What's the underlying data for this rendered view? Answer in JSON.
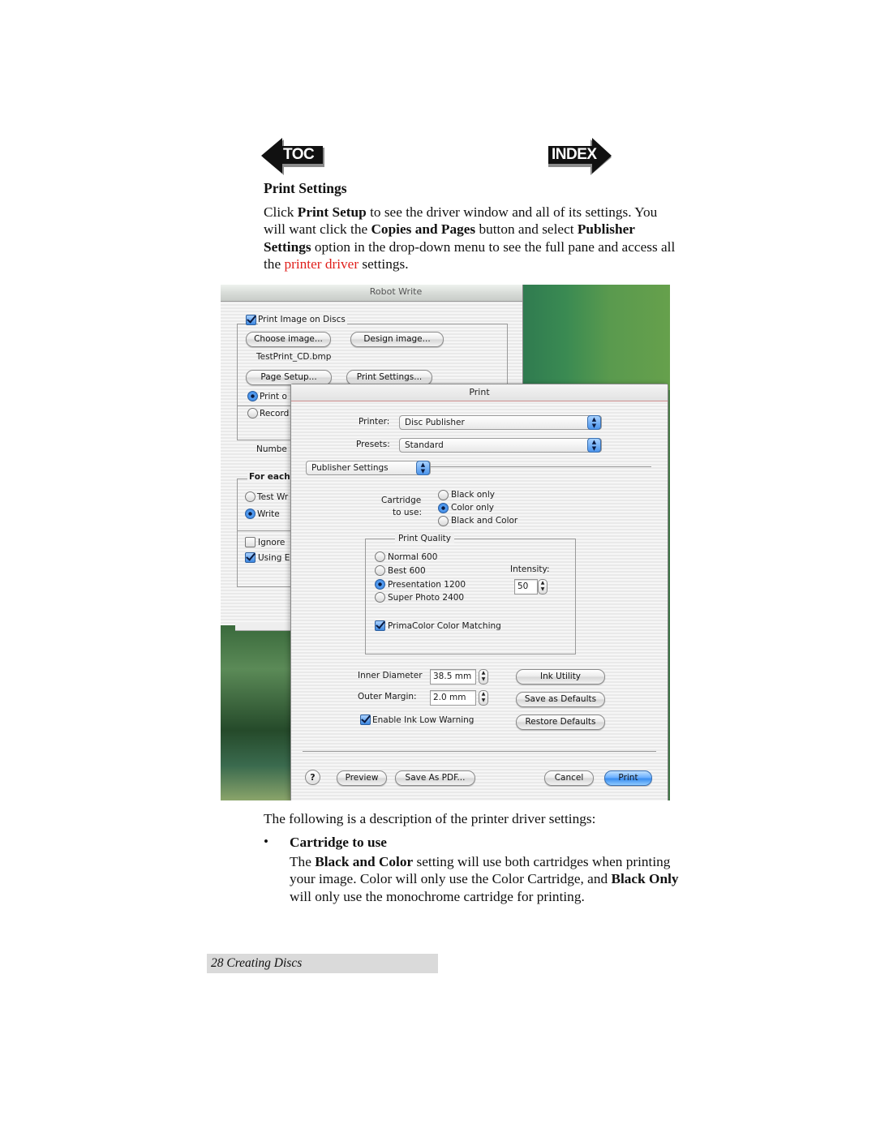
{
  "nav": {
    "toc_label": "TOC",
    "index_label": "INDEX"
  },
  "section": {
    "heading": "Print Settings",
    "intro": {
      "t1": "Click ",
      "b1": "Print Setup",
      "t2": " to see the driver window and all of its settings. You will want click the ",
      "b2": "Copies and Pages",
      "t3": " button and select ",
      "b3": "Publisher Settings",
      "t4": " option in the drop-down menu to see the full pane and access all the ",
      "link": "printer driver",
      "t5": " settings."
    }
  },
  "screenshot": {
    "robot_write": {
      "title": "Robot Write",
      "print_image_label": "Print Image on Discs",
      "print_image_checked": true,
      "choose_image": "Choose image...",
      "design_image": "Design image...",
      "file_name": "TestPrint_CD.bmp",
      "page_setup": "Page Setup...",
      "print_settings": "Print Settings...",
      "radio_print_partial": "Print o",
      "radio_record_partial": "Record",
      "number_partial": "Numbe",
      "for_each_partial": "For each",
      "test_write_partial": "Test Wr",
      "write_label": "Write",
      "ignore_partial": "Ignore",
      "using_partial": "Using E"
    },
    "print_dialog": {
      "title": "Print",
      "printer_label": "Printer:",
      "printer_value": "Disc Publisher",
      "presets_label": "Presets:",
      "presets_value": "Standard",
      "pane_value": "Publisher Settings",
      "cartridge_label_1": "Cartridge",
      "cartridge_label_2": "to use:",
      "cartridge_options": [
        "Black only",
        "Color only",
        "Black and Color"
      ],
      "cartridge_selected": "Color only",
      "quality_title": "Print Quality",
      "quality_options": [
        "Normal 600",
        "Best 600",
        "Presentation 1200",
        "Super Photo 2400"
      ],
      "quality_selected": "Presentation 1200",
      "intensity_label": "Intensity:",
      "intensity_value": "50",
      "primacolor_label": "PrimaColor Color Matching",
      "primacolor_checked": true,
      "inner_diameter_label": "Inner Diameter",
      "inner_diameter_value": "38.5 mm",
      "outer_margin_label": "Outer Margin:",
      "outer_margin_value": "2.0 mm",
      "ink_low_label": "Enable Ink Low Warning",
      "ink_low_checked": true,
      "ink_utility": "Ink Utility",
      "save_defaults": "Save as Defaults",
      "restore_defaults": "Restore Defaults",
      "help": "?",
      "preview": "Preview",
      "save_pdf": "Save As PDF...",
      "cancel": "Cancel",
      "print": "Print"
    }
  },
  "description": {
    "caption": "The following is a description of the printer driver settings:",
    "bullet": "•",
    "item_title": "Cartridge to use",
    "item_body": {
      "t1": "The ",
      "b1": "Black and Color",
      "t2": " setting will use both cartridges when printing your image. Color will only use the Color Cartridge, and ",
      "b2": "Black Only",
      "t3": " will only use the monochrome cartridge for printing."
    }
  },
  "footer": {
    "page_label": "28  Creating Discs"
  },
  "colors": {
    "link": "#e0201c",
    "footer_bg": "#dadada",
    "desktop_green": "#3f7a48",
    "aqua_blue": "#3a8ef0"
  }
}
